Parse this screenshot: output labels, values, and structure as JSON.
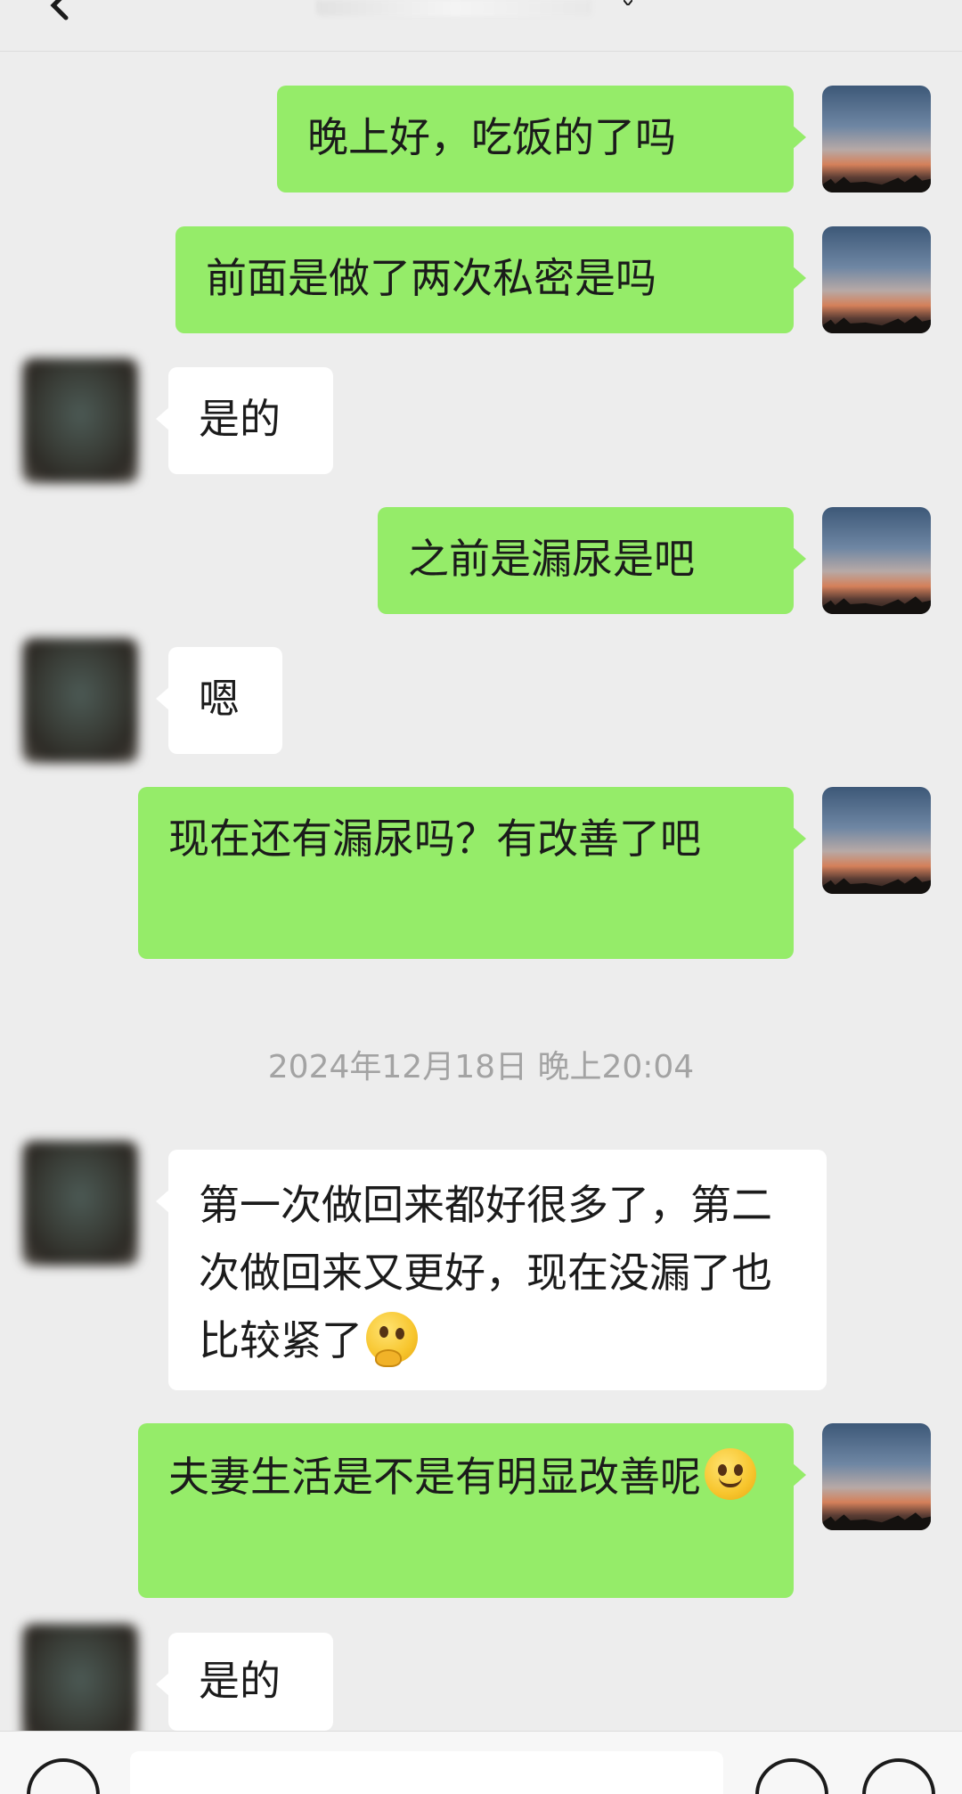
{
  "header": {
    "back_icon": "chevron-left-icon",
    "contact_name": ""
  },
  "messages": [
    {
      "side": "out",
      "text": "晚上好，吃饭的了吗"
    },
    {
      "side": "out",
      "text": "前面是做了两次私密是吗"
    },
    {
      "side": "in",
      "text": "是的"
    },
    {
      "side": "out",
      "text": "之前是漏尿是吧"
    },
    {
      "side": "in",
      "text": "嗯"
    },
    {
      "side": "out",
      "text": "现在还有漏尿吗？有改善了吧"
    },
    {
      "side": "in",
      "text": "第一次做回来都好很多了，第二次做回来又更好，现在没漏了也比较紧了",
      "emoji": "thinking-face-emoji"
    },
    {
      "side": "out",
      "text": "夫妻生活是不是有明显改善呢",
      "emoji": "smiling-face-emoji"
    },
    {
      "side": "in",
      "text": "是的"
    }
  ],
  "timestamp": "2024年12月18日 晚上20:04",
  "input_bar": {
    "voice_icon": "voice-icon",
    "emoji_icon": "emoji-icon",
    "plus_icon": "plus-icon",
    "value": ""
  },
  "colors": {
    "background": "#ededed",
    "outgoing_bubble": "#95ec69",
    "incoming_bubble": "#ffffff",
    "timestamp_text": "#a3a3a3"
  }
}
